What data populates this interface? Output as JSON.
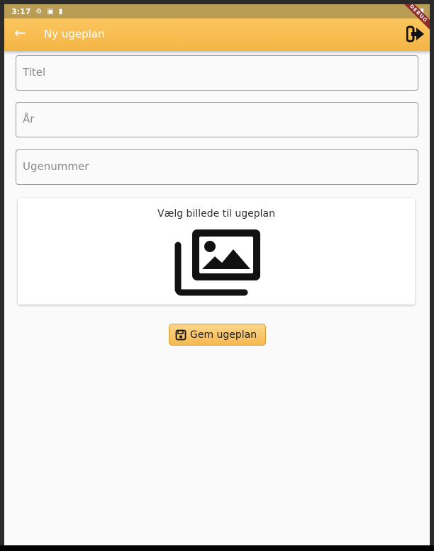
{
  "statusbar": {
    "time": "3:17",
    "icons": [
      "gear-icon",
      "sim-a-icon",
      "sd-card-icon"
    ],
    "right_icons": [
      "wifi-icon",
      "battery-icon"
    ]
  },
  "appbar": {
    "back_icon": "arrow-left-icon",
    "title": "Ny ugeplan",
    "action_icon": "logout-icon",
    "debug_banner": "DEBUG"
  },
  "form": {
    "title_placeholder": "Titel",
    "year_placeholder": "År",
    "week_placeholder": "Ugenummer"
  },
  "image_picker": {
    "label": "Vælg billede til ugeplan",
    "icon": "photo-library-icon"
  },
  "save_button": {
    "label": "Gem ugeplan",
    "icon": "save-icon"
  },
  "colors": {
    "appbar": "#f6b94f",
    "statusbar": "#b99d55",
    "button": "#f6b94f"
  }
}
